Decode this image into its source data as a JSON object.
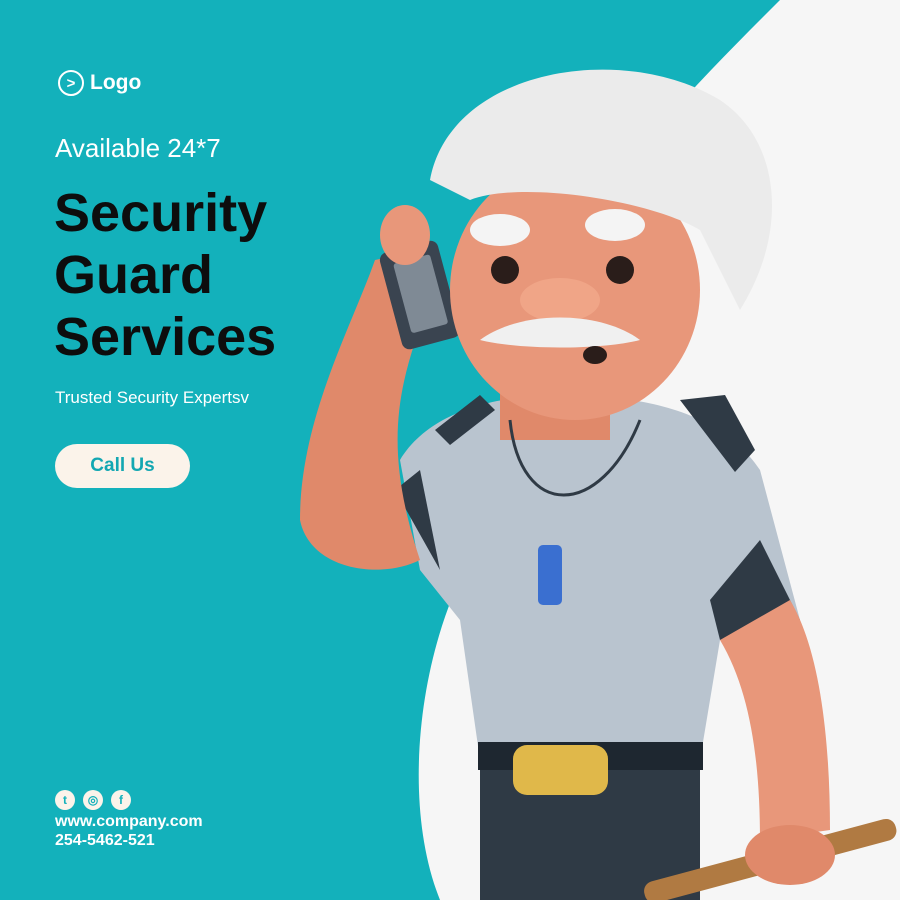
{
  "logo": {
    "label": "Logo",
    "icon": "chevron-right-circle-icon"
  },
  "availability": "Available 24*7",
  "title_lines": [
    "Security",
    "Guard",
    "Services"
  ],
  "tagline": "Trusted Security Expertsv",
  "cta_label": "Call Us",
  "social": {
    "twitter": "t",
    "instagram": "◎",
    "facebook": "f"
  },
  "website": "www.company.com",
  "phone": "254-5462-521",
  "colors": {
    "background": "#13b1bb",
    "button": "#fbf3ea",
    "title": "#0d0d0d"
  }
}
